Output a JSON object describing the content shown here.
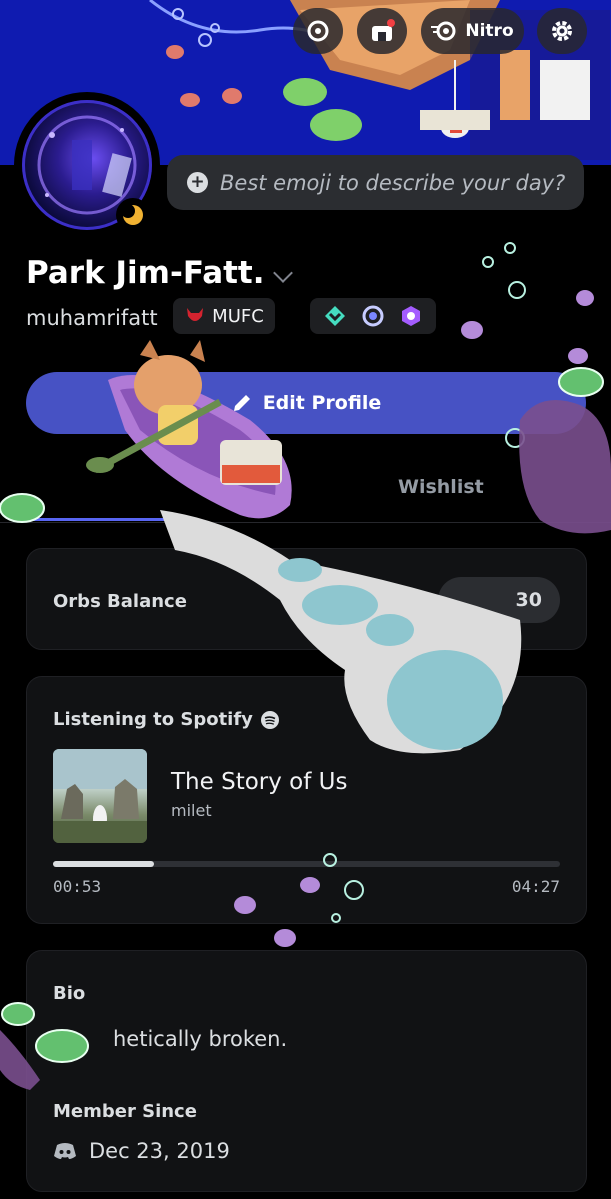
{
  "header": {
    "nitro_label": "Nitro"
  },
  "status": {
    "placeholder": "Best emoji to describe your day?"
  },
  "profile": {
    "display_name": "Park Jim-Fatt.",
    "username": "muhamrifatt",
    "clan_tag": "MUFC",
    "badges": [
      "hypesquad-balance-icon",
      "nitro-laurel-icon",
      "quest-badge-icon"
    ]
  },
  "actions": {
    "edit_profile_label": "Edit Profile"
  },
  "tabs": {
    "items": [
      {
        "label": "Wishlist"
      }
    ]
  },
  "orbs": {
    "label": "Orbs Balance",
    "value_partial": "30"
  },
  "spotify": {
    "heading": "Listening to Spotify",
    "song": "The Story of Us",
    "artist": "milet",
    "elapsed": "00:53",
    "duration": "04:27",
    "progress": 0.2
  },
  "bio": {
    "heading": "Bio",
    "text": "hetically broken.",
    "member_since_heading": "Member Since",
    "member_since": "Dec 23, 2019"
  },
  "colors": {
    "accent": "#5865f2",
    "edit_button": "#4752c4",
    "card_bg": "#111214",
    "banner_blue": "#0f1bb0"
  }
}
